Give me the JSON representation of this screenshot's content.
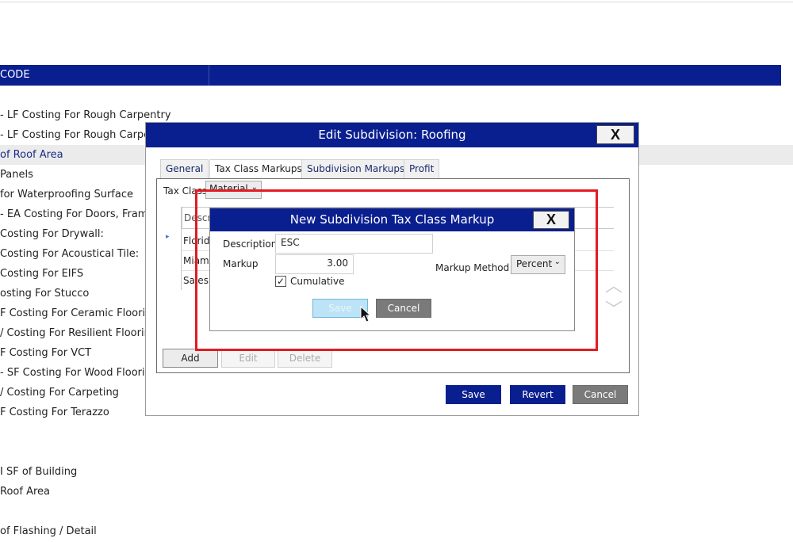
{
  "background": {
    "header_code": "CODE",
    "rows": [
      "- LF Costing For Rough Carpentry",
      "- LF Costing For Rough Carpe",
      "of Roof Area",
      "Panels",
      "for Waterproofing Surface",
      "- EA Costing For Doors, Frame",
      "Costing For Drywall:",
      "Costing For Acoustical Tile:",
      "Costing For EIFS",
      "osting For Stucco",
      "F Costing For Ceramic Flooring",
      "/ Costing For Resilient Flooring",
      "F Costing For VCT",
      "- SF Costing For Wood Floorin",
      "/ Costing For Carpeting",
      "F Costing For Terazzo",
      "",
      "",
      "I SF of Building",
      "Roof Area",
      "",
      "of Flashing / Detail"
    ]
  },
  "outer_dialog": {
    "title": "Edit Subdivision: Roofing",
    "close_label": "X",
    "tabs": [
      "General",
      "Tax Class Markups",
      "Subdivision Markups",
      "Profit"
    ],
    "tax_class_label": "Tax Class",
    "tax_class_value": "Material",
    "grid_header": "Descri",
    "grid_rows": [
      "Florida",
      "Miami",
      "Sales T"
    ],
    "add_label": "Add",
    "edit_label": "Edit",
    "delete_label": "Delete",
    "save_label": "Save",
    "revert_label": "Revert",
    "cancel_label": "Cancel"
  },
  "inner_dialog": {
    "title": "New Subdivision Tax Class Markup",
    "close_label": "X",
    "description_label": "Description",
    "description_value": "ESC",
    "markup_label": "Markup",
    "markup_value": "3.00",
    "cumulative_label": "Cumulative",
    "cumulative_checked": "✓",
    "markup_method_label": "Markup Method",
    "markup_method_value": "Percent",
    "save_label": "Save",
    "cancel_label": "Cancel"
  },
  "colors": {
    "title_bar": "#0a1f8f",
    "highlight": "#e21b22",
    "save_disabled": "#bde3f7"
  }
}
